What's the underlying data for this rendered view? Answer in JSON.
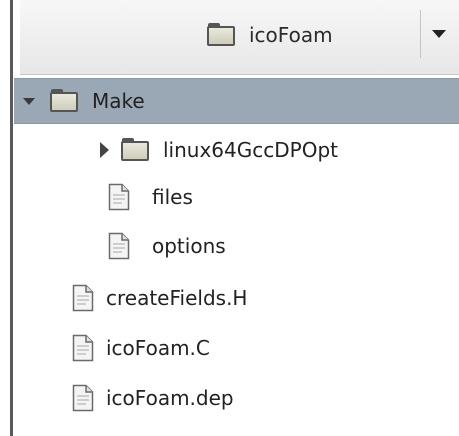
{
  "header": {
    "path_label": "icoFoam"
  },
  "tree": [
    {
      "label": "Make",
      "kind": "folder",
      "depth": 0,
      "expanded": true,
      "selected": true
    },
    {
      "label": "linux64GccDPOpt",
      "kind": "folder",
      "depth": 1,
      "expanded": false,
      "selected": false
    },
    {
      "label": "files",
      "kind": "file",
      "depth": 1,
      "selected": false
    },
    {
      "label": "options",
      "kind": "file",
      "depth": 1,
      "selected": false
    },
    {
      "label": "createFields.H",
      "kind": "file",
      "depth": 0,
      "selected": false
    },
    {
      "label": "icoFoam.C",
      "kind": "file",
      "depth": 0,
      "selected": false
    },
    {
      "label": "icoFoam.dep",
      "kind": "file",
      "depth": 0,
      "selected": false
    }
  ],
  "colors": {
    "selected_row": "#9aa7b4",
    "header_bg": "#eeeeee"
  },
  "icons": {
    "folder": "folder-icon",
    "file": "file-icon",
    "expand": "triangle-down-icon",
    "collapse": "triangle-right-icon",
    "dropdown": "chevron-down-icon"
  }
}
